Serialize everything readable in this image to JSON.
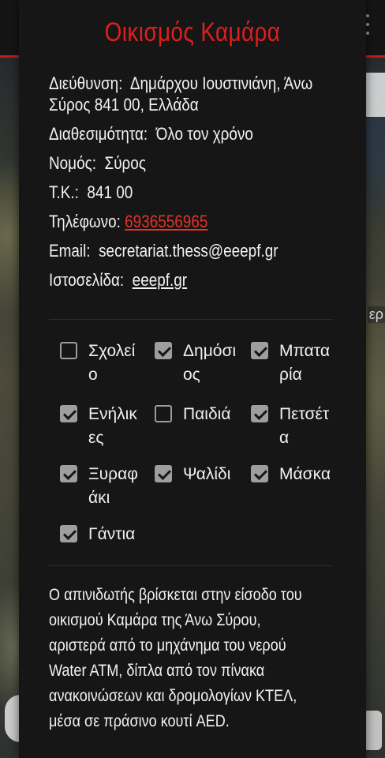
{
  "map": {
    "label_fragment": "ερ"
  },
  "card": {
    "title": "Οικισμός Καμάρα",
    "address_label": "Διεύθυνση:",
    "address_line1": "Δημάρχου Ιουστινιάνη, Άνω",
    "address_line2": "Σύρος 841 00, Ελλάδα",
    "availability_label": "Διαθεσιμότητα:",
    "availability_value": "Όλο τον χρόνο",
    "prefecture_label": "Νομός:",
    "prefecture_value": "Σύρος",
    "postcode_label": "Τ.Κ.:",
    "postcode_value": "841 00",
    "phone_label": "Τηλέφωνο:",
    "phone_value": "6936556965",
    "email_label": "Email:",
    "email_value": "secretariat.thess@eeepf.gr",
    "website_label": "Ιστοσελίδα:",
    "website_value": "eeepf.gr"
  },
  "checklist": [
    {
      "label": "Σχολείο",
      "checked": false
    },
    {
      "label": "Δημόσιος",
      "checked": true
    },
    {
      "label": "Μπαταρία",
      "checked": true
    },
    {
      "label": "Ενήλικες",
      "checked": true
    },
    {
      "label": "Παιδιά",
      "checked": false
    },
    {
      "label": "Πετσέτα",
      "checked": true
    },
    {
      "label": "Ξυραφάκι",
      "checked": true
    },
    {
      "label": "Ψαλίδι",
      "checked": true
    },
    {
      "label": "Μάσκα",
      "checked": true
    },
    {
      "label": "Γάντια",
      "checked": true
    }
  ],
  "description": {
    "line1": "Ο απινιδωτής βρίσκεται στην είσοδο του",
    "line2": "οικισμού Καμάρα της Άνω Σύρου,",
    "line3": "αριστερά από το μηχάνημα του νερού",
    "line4": "Water ATM, δίπλα από τον πίνακα",
    "line5": "ανακοινώσεων και δρομολογίων ΚΤΕΛ,",
    "line6": "μέσα σε πράσινο κουτί AED."
  },
  "colors": {
    "accent_red": "#e01e1e",
    "card_bg": "#161616",
    "checkbox_gray": "#9e9e9e"
  }
}
